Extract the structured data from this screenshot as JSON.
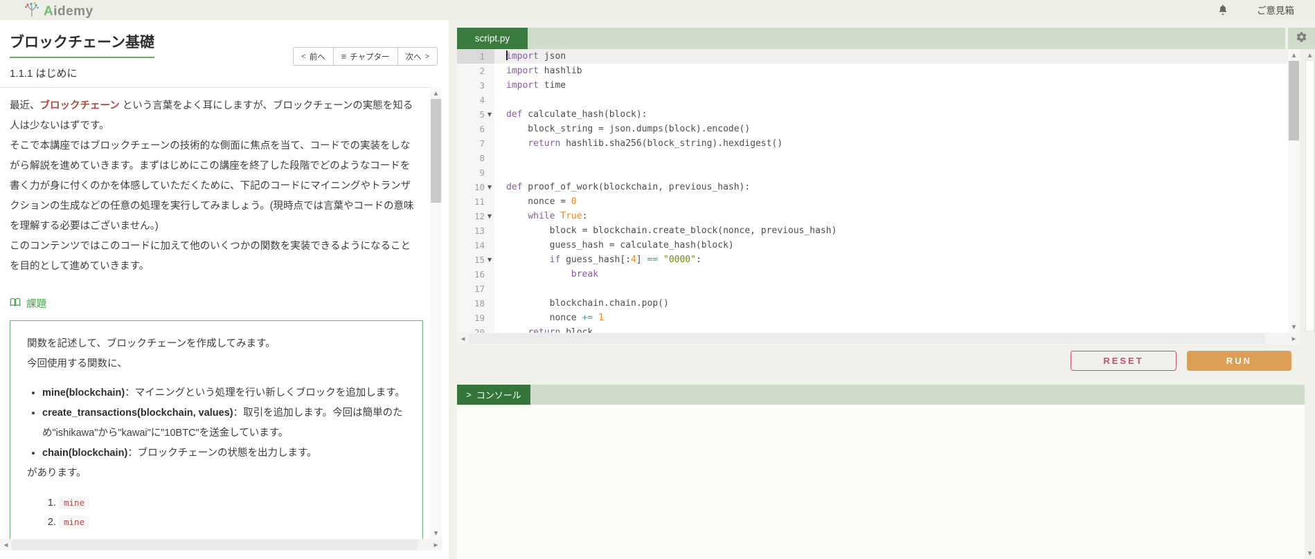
{
  "header": {
    "brand_first": "A",
    "brand_rest": "idemy",
    "feedback_label": "ご意見箱"
  },
  "lesson": {
    "title": "ブロックチェーン基礎",
    "section": "1.1.1 はじめに",
    "nav": {
      "prev_icon": "<",
      "prev": "前へ",
      "menu_icon": "≡",
      "chapter": "チャプター",
      "next": "次へ",
      "next_icon": ">"
    },
    "paragraphs": {
      "p1_pre": "最近、",
      "p1_em": "ブロックチェーン",
      "p1_post": " という言葉をよく耳にしますが、ブロックチェーンの実態を知る人は少ないはずです。",
      "p2": "そこで本講座ではブロックチェーンの技術的な側面に焦点を当て、コードでの実装をしながら解説を進めていきます。まずはじめにこの講座を終了した段階でどのようなコードを書く力が身に付くのかを体感していただくために、下記のコードにマイニングやトランザクションの生成などの任意の処理を実行してみましょう。(現時点では言葉やコードの意味を理解する必要はございません。)",
      "p3": "このコンテンツではこのコードに加えて他のいくつかの関数を実装できるようになることを目的として進めていきます。"
    },
    "assignment": {
      "heading": "課題",
      "intro1": "関数を記述して、ブロックチェーンを作成してみます。",
      "intro2": "今回使用する関数に、",
      "functions": [
        {
          "name": "mine(blockchain)",
          "desc": "：マイニングという処理を行い新しくブロックを追加します。"
        },
        {
          "name": "create_transactions(blockchain, values)",
          "desc": "：取引を追加します。今回は簡単のため\"ishikawa\"から\"kawai\"に\"10BTC\"を送金しています。"
        },
        {
          "name": "chain(blockchain)",
          "desc": "：ブロックチェーンの状態を出力します。"
        }
      ],
      "outro": "があります。",
      "steps": [
        "mine",
        "mine"
      ]
    }
  },
  "editor": {
    "tab": "script.py",
    "active_line": 1,
    "fold_lines": [
      5,
      10,
      12,
      15
    ],
    "lines": [
      [
        [
          "kw",
          "import"
        ],
        [
          "pl",
          " json"
        ]
      ],
      [
        [
          "kw",
          "import"
        ],
        [
          "pl",
          " hashlib"
        ]
      ],
      [
        [
          "kw",
          "import"
        ],
        [
          "pl",
          " time"
        ]
      ],
      [],
      [
        [
          "kw",
          "def"
        ],
        [
          "pl",
          " calculate_hash(block):"
        ]
      ],
      [
        [
          "pl",
          "    block_string = json.dumps(block).encode()"
        ]
      ],
      [
        [
          "pl",
          "    "
        ],
        [
          "kw",
          "return"
        ],
        [
          "pl",
          " hashlib.sha256(block_string).hexdigest()"
        ]
      ],
      [],
      [],
      [
        [
          "kw",
          "def"
        ],
        [
          "pl",
          " proof_of_work(blockchain, previous_hash):"
        ]
      ],
      [
        [
          "pl",
          "    nonce = "
        ],
        [
          "num",
          "0"
        ]
      ],
      [
        [
          "pl",
          "    "
        ],
        [
          "kw",
          "while"
        ],
        [
          "pl",
          " "
        ],
        [
          "num",
          "True"
        ],
        [
          "pl",
          ":"
        ]
      ],
      [
        [
          "pl",
          "        block = blockchain.create_block(nonce, previous_hash)"
        ]
      ],
      [
        [
          "pl",
          "        guess_hash = calculate_hash(block)"
        ]
      ],
      [
        [
          "pl",
          "        "
        ],
        [
          "kw",
          "if"
        ],
        [
          "pl",
          " guess_hash[:"
        ],
        [
          "num",
          "4"
        ],
        [
          "pl",
          "] "
        ],
        [
          "op",
          "=="
        ],
        [
          "pl",
          " "
        ],
        [
          "str",
          "\"0000\""
        ],
        [
          "pl",
          ":"
        ]
      ],
      [
        [
          "pl",
          "            "
        ],
        [
          "kw",
          "break"
        ]
      ],
      [],
      [
        [
          "pl",
          "        blockchain.chain.pop()"
        ]
      ],
      [
        [
          "pl",
          "        nonce "
        ],
        [
          "op",
          "+="
        ],
        [
          "pl",
          " "
        ],
        [
          "num",
          "1"
        ]
      ],
      [
        [
          "pl",
          "    "
        ],
        [
          "kw",
          "return"
        ],
        [
          "pl",
          " block"
        ]
      ]
    ]
  },
  "actions": {
    "reset_label": "RESET",
    "run_label": "RUN"
  },
  "console": {
    "prompt": ">",
    "label": "コンソール"
  },
  "colors": {
    "tab_green": "#3a7a3e",
    "bar_light_green": "#cedcc9",
    "run_orange": "#dd9e55",
    "reset_pink": "#c94b71",
    "emphasis_red": "#b2453e",
    "assignment_green": "#53a257",
    "syntax_keyword": "#8959a8",
    "syntax_number": "#f5871f",
    "syntax_string": "#718c00",
    "syntax_operator": "#3e999f"
  }
}
